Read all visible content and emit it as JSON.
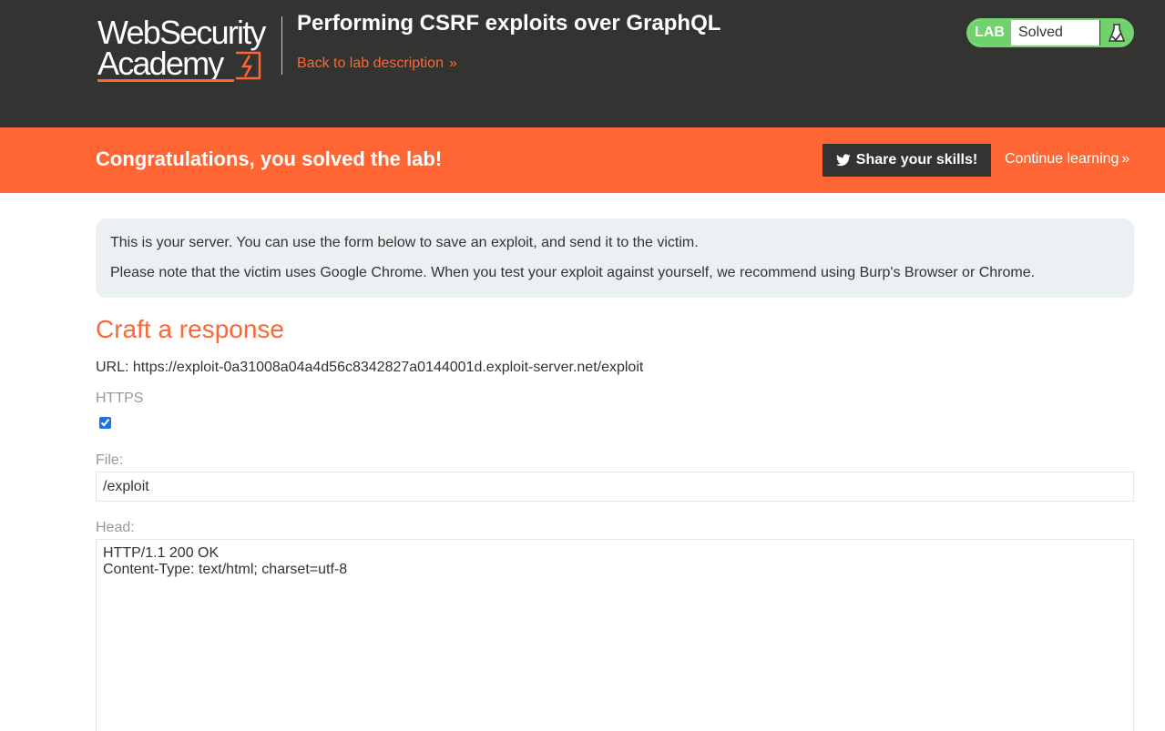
{
  "header": {
    "logo_line1": "WebSecurity",
    "logo_line2": "Academy",
    "lab_title": "Performing CSRF exploits over GraphQL",
    "back_link": "Back to lab description",
    "back_link_chevron": "»",
    "lab_badge": "LAB",
    "lab_status": "Solved",
    "status_icon": "flask-icon"
  },
  "banner": {
    "message": "Congratulations, you solved the lab!",
    "share_label": "Share your skills!",
    "share_icon": "twitter-icon",
    "continue_label": "Continue learning",
    "continue_chevron": "»"
  },
  "info": {
    "line1": "This is your server. You can use the form below to save an exploit, and send it to the victim.",
    "line2": "Please note that the victim uses Google Chrome. When you test your exploit against yourself, we recommend using Burp's Browser or Chrome."
  },
  "form": {
    "section_title": "Craft a response",
    "url_text": "URL: https://exploit-0a31008a04a4d56c8342827a0144001d.exploit-server.net/exploit",
    "https_label": "HTTPS",
    "https_checked": true,
    "file_label": "File:",
    "file_value": "/exploit",
    "head_label": "Head:",
    "head_value": "HTTP/1.1 200 OK\nContent-Type: text/html; charset=utf-8"
  },
  "colors": {
    "header_bg": "#333332",
    "accent_orange": "#ff6633",
    "solved_green": "#70d16d",
    "info_bg": "#ebf0f2"
  }
}
